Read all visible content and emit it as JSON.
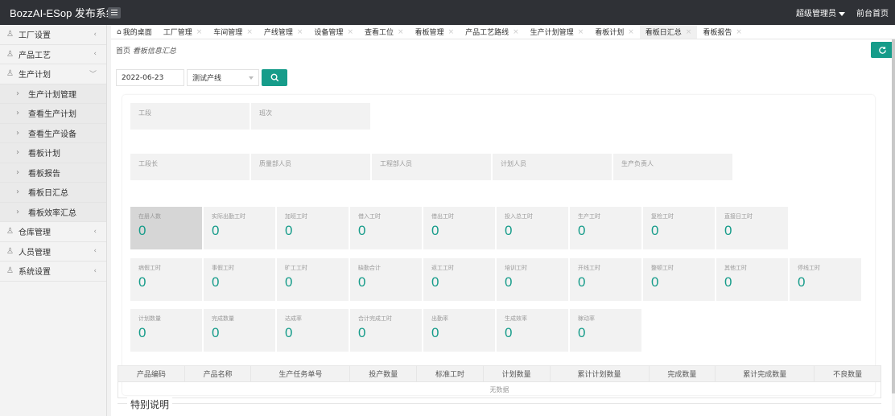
{
  "app": {
    "title": "BozzAI-ESop 发布系统"
  },
  "topbar": {
    "user": "超级管理员",
    "home": "前台首页"
  },
  "sidebar": {
    "items": [
      {
        "label": "工厂设置",
        "icon": "user-icon",
        "arrow": "<",
        "sub": false
      },
      {
        "label": "产品工艺",
        "icon": "user-icon",
        "arrow": "<",
        "sub": false
      },
      {
        "label": "生产计划",
        "icon": "user-icon",
        "arrow": "v",
        "sub": false
      },
      {
        "label": "生产计划管理",
        "icon": "chevron-right-icon",
        "arrow": "",
        "sub": true
      },
      {
        "label": "查看生产计划",
        "icon": "chevron-right-icon",
        "arrow": "",
        "sub": true
      },
      {
        "label": "查看生产设备",
        "icon": "chevron-right-icon",
        "arrow": "",
        "sub": true
      },
      {
        "label": "看板计划",
        "icon": "chevron-right-icon",
        "arrow": "",
        "sub": true
      },
      {
        "label": "看板报告",
        "icon": "chevron-right-icon",
        "arrow": "",
        "sub": true
      },
      {
        "label": "看板日汇总",
        "icon": "chevron-right-icon",
        "arrow": "",
        "sub": true
      },
      {
        "label": "看板效率汇总",
        "icon": "chevron-right-icon",
        "arrow": "",
        "sub": true
      },
      {
        "label": "仓库管理",
        "icon": "user-icon",
        "arrow": "<",
        "sub": false
      },
      {
        "label": "人员管理",
        "icon": "user-icon",
        "arrow": "<",
        "sub": false
      },
      {
        "label": "系统设置",
        "icon": "user-icon",
        "arrow": "<",
        "sub": false
      }
    ]
  },
  "tabs": [
    {
      "label": "我的桌面",
      "active": false,
      "home": true
    },
    {
      "label": "工厂管理",
      "active": false
    },
    {
      "label": "车间管理",
      "active": false
    },
    {
      "label": "产线管理",
      "active": false
    },
    {
      "label": "设备管理",
      "active": false
    },
    {
      "label": "查看工位",
      "active": false
    },
    {
      "label": "看板管理",
      "active": false
    },
    {
      "label": "产品工艺路线",
      "active": false
    },
    {
      "label": "生产计划管理",
      "active": false
    },
    {
      "label": "看板计划",
      "active": false
    },
    {
      "label": "看板日汇总",
      "active": true
    },
    {
      "label": "看板报告",
      "active": false
    }
  ],
  "breadcrumb": {
    "home": "首页",
    "current": "看板信息汇总"
  },
  "filter": {
    "date": "2022-06-23",
    "line": "测试产线"
  },
  "info_rows": [
    [
      "工段",
      "班次"
    ],
    [
      "工段长",
      "质量部人员",
      "工程部人员",
      "计划人员",
      "生产负责人"
    ]
  ],
  "stat_rows": [
    [
      {
        "label": "在册人数",
        "value": "0",
        "hl": true
      },
      {
        "label": "实际出勤工时",
        "value": "0"
      },
      {
        "label": "加班工时",
        "value": "0"
      },
      {
        "label": "借入工时",
        "value": "0"
      },
      {
        "label": "借出工时",
        "value": "0"
      },
      {
        "label": "投入总工时",
        "value": "0"
      },
      {
        "label": "生产工时",
        "value": "0"
      },
      {
        "label": "复检工时",
        "value": "0"
      },
      {
        "label": "直接日工时",
        "value": "0"
      }
    ],
    [
      {
        "label": "病假工时",
        "value": "0"
      },
      {
        "label": "事假工时",
        "value": "0"
      },
      {
        "label": "旷工工时",
        "value": "0"
      },
      {
        "label": "缺勤合计",
        "value": "0"
      },
      {
        "label": "返工工时",
        "value": "0"
      },
      {
        "label": "培训工时",
        "value": "0"
      },
      {
        "label": "开线工时",
        "value": "0"
      },
      {
        "label": "整顿工时",
        "value": "0"
      },
      {
        "label": "其他工时",
        "value": "0"
      },
      {
        "label": "停线工时",
        "value": "0"
      }
    ],
    [
      {
        "label": "计划数量",
        "value": "0"
      },
      {
        "label": "完成数量",
        "value": "0"
      },
      {
        "label": "达成率",
        "value": "0"
      },
      {
        "label": "合计完成工时",
        "value": "0"
      },
      {
        "label": "出勤率",
        "value": "0"
      },
      {
        "label": "生成效率",
        "value": "0"
      },
      {
        "label": "稼动率",
        "value": "0"
      }
    ]
  ],
  "table": {
    "headers": [
      "产品编码",
      "产品名称",
      "生产任务单号",
      "投产数量",
      "标准工时",
      "计划数量",
      "累计计划数量",
      "完成数量",
      "累计完成数量",
      "不良数量"
    ],
    "empty": "无数据"
  },
  "special_title": "特别说明",
  "colors": {
    "accent": "#169c8a",
    "topbar": "#2f3136"
  }
}
